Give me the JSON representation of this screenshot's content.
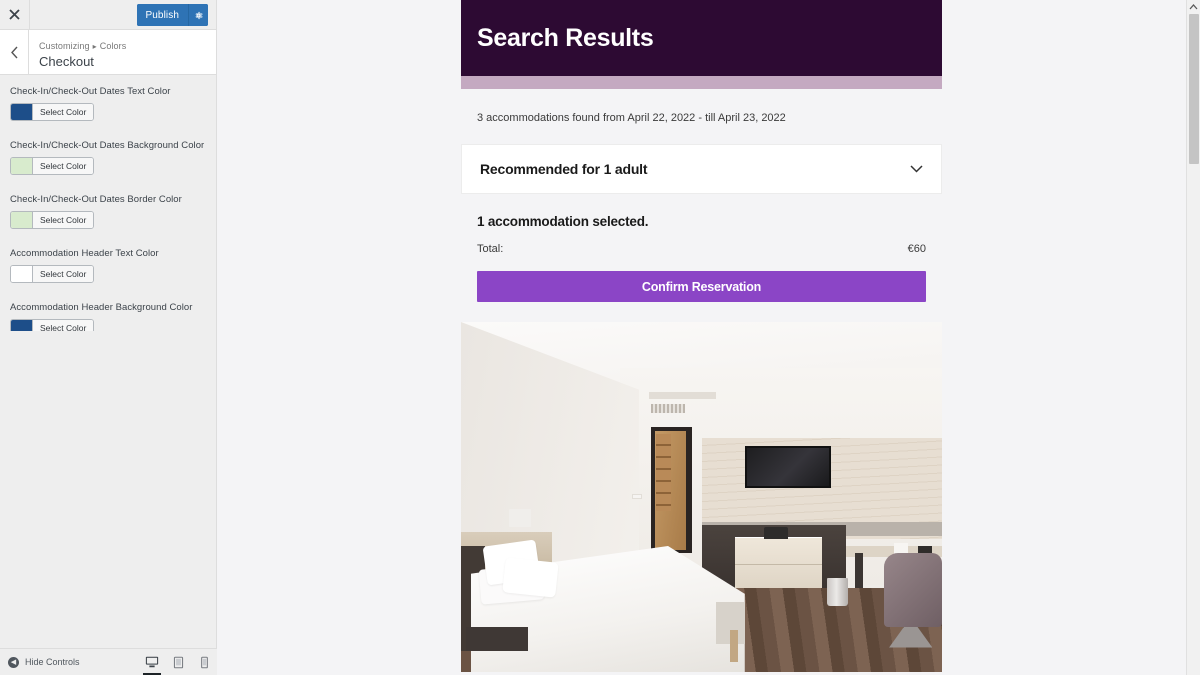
{
  "customizer": {
    "close_label": "×",
    "close_icon": "close-icon",
    "publish_label": "Publish",
    "gear_icon": "gear-icon",
    "back_icon": "chevron-left-icon",
    "breadcrumb": {
      "root": "Customizing",
      "separator": "▸",
      "parent": "Colors"
    },
    "section_title": "Checkout",
    "controls": [
      {
        "label": "Check-In/Check-Out Dates Text Color",
        "button_label": "Select Color",
        "swatch": "#1d4e89"
      },
      {
        "label": "Check-In/Check-Out Dates Background Color",
        "button_label": "Select Color",
        "swatch": "#d8ebcd"
      },
      {
        "label": "Check-In/Check-Out Dates Border Color",
        "button_label": "Select Color",
        "swatch": "#d8ebcd"
      },
      {
        "label": "Accommodation Header Text Color",
        "button_label": "Select Color",
        "swatch": "#ffffff"
      },
      {
        "label": "Accommodation Header Background Color",
        "button_label": "Select Color",
        "swatch": "#1d4e89"
      }
    ],
    "footer": {
      "hide_controls_label": "Hide Controls",
      "devices": [
        {
          "name": "desktop",
          "icon": "desktop-icon",
          "active": true
        },
        {
          "name": "tablet",
          "icon": "tablet-icon",
          "active": false
        },
        {
          "name": "mobile",
          "icon": "mobile-icon",
          "active": false
        }
      ]
    }
  },
  "preview": {
    "hero_title": "Search Results",
    "results_text": "3 accommodations found from April 22, 2022 - till April 23, 2022",
    "accordion": {
      "title": "Recommended for 1 adult",
      "chevron_icon": "chevron-down-icon"
    },
    "summary": {
      "selected_text": "1 accommodation selected.",
      "total_label": "Total:",
      "total_amount": "€60",
      "confirm_label": "Confirm Reservation"
    },
    "room_photo_alt": "hotel-room-photo",
    "colors": {
      "hero_background": "#2d0a33",
      "band": "#c4a9c1",
      "confirm_button": "#8b45c6",
      "page_background": "#f4f4f6"
    },
    "scrollbar": {
      "up_icon": "chevron-up-icon"
    }
  }
}
